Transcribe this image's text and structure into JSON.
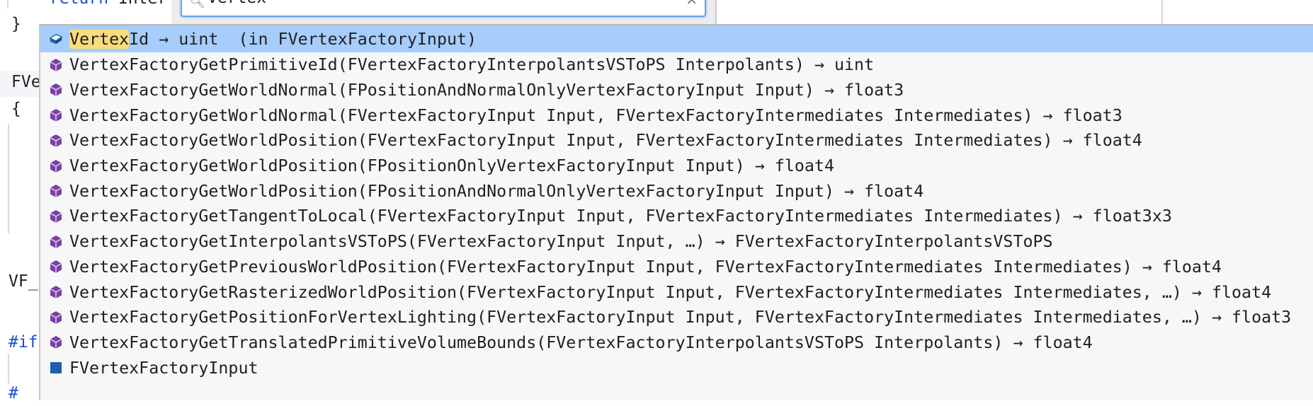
{
  "editor": {
    "lines": [
      {
        "keyword": "return",
        "text": " Inter"
      },
      {
        "text": "}"
      },
      {
        "text": "FVe"
      },
      {
        "text": "{"
      },
      {
        "text": "VF_"
      },
      {
        "keyword": "#if",
        "text": ""
      },
      {
        "keyword": "#",
        "text": ""
      }
    ]
  },
  "search": {
    "value": "Vertex",
    "icon": "search-icon",
    "close_icon": "close-icon"
  },
  "colors": {
    "selected_row": "#a6cdfb",
    "match_highlight": "#fbdc7a",
    "method_icon": "#7b3fa8",
    "field_icon": "#1c5fae"
  },
  "completion": {
    "items": [
      {
        "icon": "field-icon",
        "match": "Vertex",
        "rest": "Id → uint  (in FVertexFactoryInput)",
        "selected": true
      },
      {
        "icon": "method-icon",
        "match": "Vertex",
        "rest": "FactoryGetPrimitiveId(FVertexFactoryInterpolantsVSToPS Interpolants) → uint"
      },
      {
        "icon": "method-icon",
        "match": "Vertex",
        "rest": "FactoryGetWorldNormal(FPositionAndNormalOnlyVertexFactoryInput Input) → float3"
      },
      {
        "icon": "method-icon",
        "match": "Vertex",
        "rest": "FactoryGetWorldNormal(FVertexFactoryInput Input, FVertexFactoryIntermediates Intermediates) → float3"
      },
      {
        "icon": "method-icon",
        "match": "Vertex",
        "rest": "FactoryGetWorldPosition(FVertexFactoryInput Input, FVertexFactoryIntermediates Intermediates) → float4"
      },
      {
        "icon": "method-icon",
        "match": "Vertex",
        "rest": "FactoryGetWorldPosition(FPositionOnlyVertexFactoryInput Input) → float4"
      },
      {
        "icon": "method-icon",
        "match": "Vertex",
        "rest": "FactoryGetWorldPosition(FPositionAndNormalOnlyVertexFactoryInput Input) → float4"
      },
      {
        "icon": "method-icon",
        "match": "Vertex",
        "rest": "FactoryGetTangentToLocal(FVertexFactoryInput Input, FVertexFactoryIntermediates Intermediates) → float3x3"
      },
      {
        "icon": "method-icon",
        "match": "Vertex",
        "rest": "FactoryGetInterpolantsVSToPS(FVertexFactoryInput Input, …) → FVertexFactoryInterpolantsVSToPS"
      },
      {
        "icon": "method-icon",
        "match": "Vertex",
        "rest": "FactoryGetPreviousWorldPosition(FVertexFactoryInput Input, FVertexFactoryIntermediates Intermediates) → float4"
      },
      {
        "icon": "method-icon",
        "match": "Vertex",
        "rest": "FactoryGetRasterizedWorldPosition(FVertexFactoryInput Input, FVertexFactoryIntermediates Intermediates, …) → float4"
      },
      {
        "icon": "method-icon",
        "match": "Vertex",
        "rest": "FactoryGetPositionForVertexLighting(FVertexFactoryInput Input, FVertexFactoryIntermediates Intermediates, …) → float3"
      },
      {
        "icon": "method-icon",
        "match": "Vertex",
        "rest": "FactoryGetTranslatedPrimitiveVolumeBounds(FVertexFactoryInterpolantsVSToPS Interpolants) → float4"
      },
      {
        "icon": "struct-icon",
        "match": "",
        "rest": "FVertexFactoryInput"
      }
    ]
  }
}
